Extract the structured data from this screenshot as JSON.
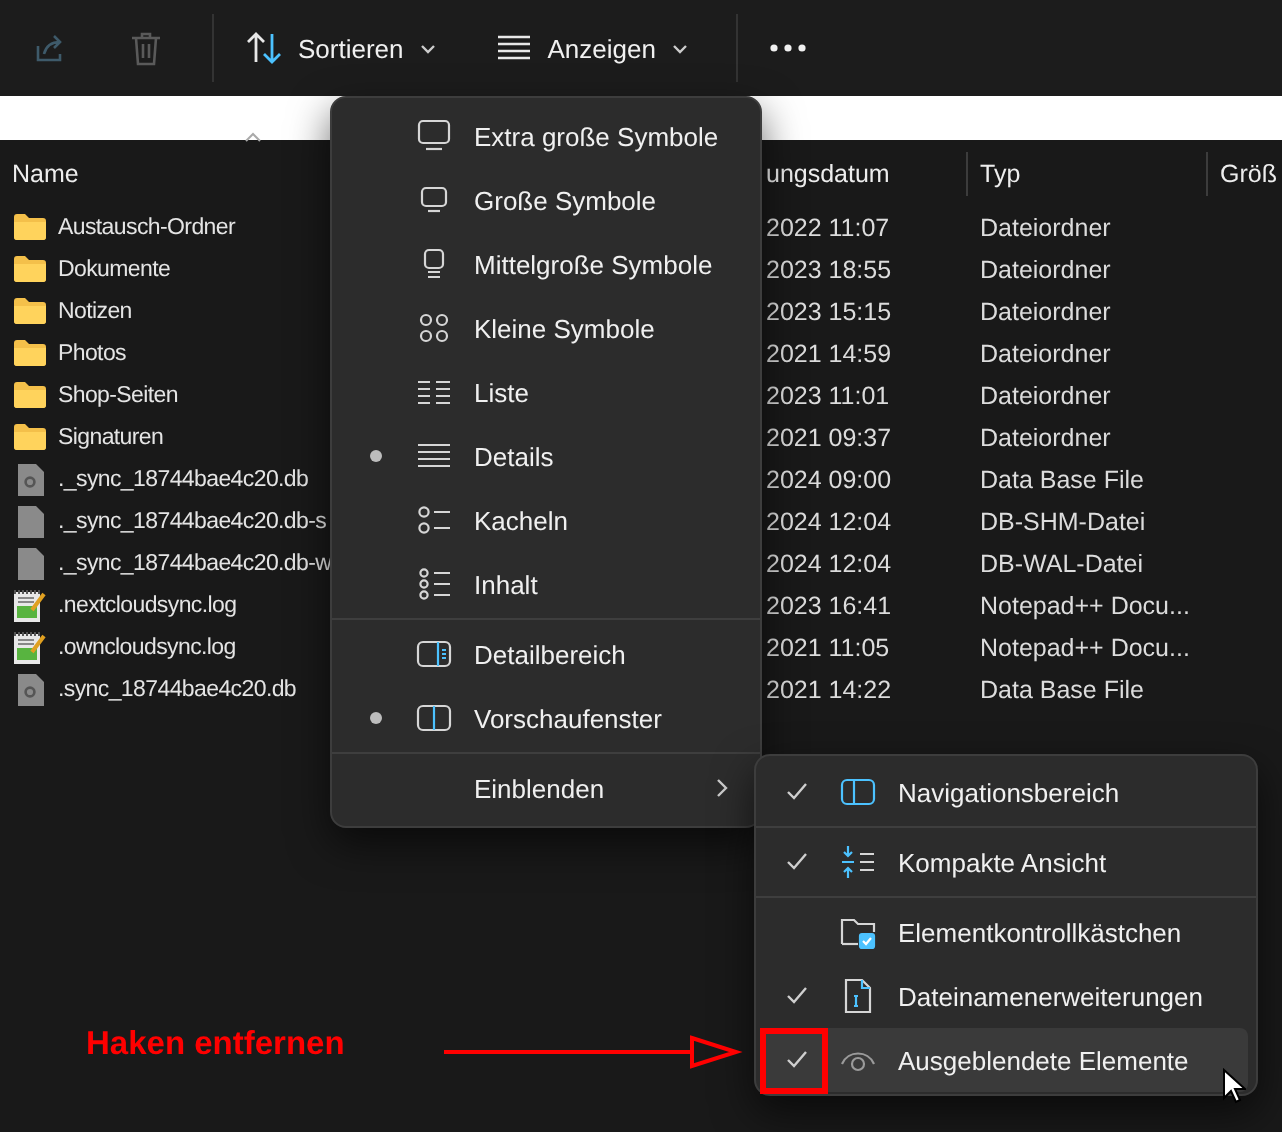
{
  "toolbar": {
    "items": [
      {
        "kind": "share",
        "disabled": true
      },
      {
        "kind": "delete",
        "disabled": true
      },
      {
        "kind": "sort",
        "label": "Sortieren",
        "disabled": false
      },
      {
        "kind": "view",
        "label": "Anzeigen",
        "disabled": false
      },
      {
        "kind": "more",
        "disabled": false
      }
    ]
  },
  "table": {
    "columns": [
      "Name",
      "ungsdatum",
      "Typ",
      "Größ"
    ],
    "rows": [
      {
        "kind": "folder",
        "name": "Austausch-Ordner",
        "date": "2022 11:07",
        "type": "Dateiordner"
      },
      {
        "kind": "folder",
        "name": "Dokumente",
        "date": "2023 18:55",
        "type": "Dateiordner"
      },
      {
        "kind": "folder",
        "name": "Notizen",
        "date": "2023 15:15",
        "type": "Dateiordner"
      },
      {
        "kind": "folder",
        "name": "Photos",
        "date": "2021 14:59",
        "type": "Dateiordner"
      },
      {
        "kind": "folder",
        "name": "Shop-Seiten",
        "date": "2023 11:01",
        "type": "Dateiordner"
      },
      {
        "kind": "folder",
        "name": "Signaturen",
        "date": "2021 09:37",
        "type": "Dateiordner"
      },
      {
        "kind": "database",
        "name": "._sync_18744bae4c20.db",
        "date": "2024 09:00",
        "type": "Data Base File"
      },
      {
        "kind": "file",
        "name": "._sync_18744bae4c20.db-s",
        "date": "2024 12:04",
        "type": "DB-SHM-Datei"
      },
      {
        "kind": "file",
        "name": "._sync_18744bae4c20.db-w",
        "date": "2024 12:04",
        "type": "DB-WAL-Datei"
      },
      {
        "kind": "notepad",
        "name": ".nextcloudsync.log",
        "date": "2023 16:41",
        "type": "Notepad++ Docu..."
      },
      {
        "kind": "notepad",
        "name": ".owncloudsync.log",
        "date": "2021 11:05",
        "type": "Notepad++ Docu..."
      },
      {
        "kind": "database",
        "name": ".sync_18744bae4c20.db",
        "date": "2021 14:22",
        "type": "Data Base File"
      }
    ]
  },
  "view_menu": {
    "groups": [
      {
        "items": [
          {
            "label": "Extra große Symbole",
            "selected": false
          },
          {
            "label": "Große Symbole",
            "selected": false
          },
          {
            "label": "Mittelgroße Symbole",
            "selected": false
          },
          {
            "label": "Kleine Symbole",
            "selected": false
          },
          {
            "label": "Liste",
            "selected": false
          },
          {
            "label": "Details",
            "selected": true
          },
          {
            "label": "Kacheln",
            "selected": false
          },
          {
            "label": "Inhalt",
            "selected": false
          }
        ]
      },
      {
        "items": [
          {
            "label": "Detailbereich",
            "selected": false
          },
          {
            "label": "Vorschaufenster",
            "selected": true
          }
        ]
      },
      {
        "items": [
          {
            "label": "Einblenden",
            "selected": false,
            "submenu": true
          }
        ]
      }
    ]
  },
  "show_submenu": {
    "groups": [
      {
        "items": [
          {
            "label": "Navigationsbereich",
            "checked": true,
            "highlighted": false
          }
        ]
      },
      {
        "items": [
          {
            "label": "Kompakte Ansicht",
            "checked": true,
            "highlighted": false
          }
        ]
      },
      {
        "items": [
          {
            "label": "Elementkontrollkästchen",
            "checked": false,
            "highlighted": false
          },
          {
            "label": "Dateinamenerweiterungen",
            "checked": true,
            "highlighted": false
          },
          {
            "label": "Ausgeblendete Elemente",
            "checked": true,
            "highlighted": true
          }
        ]
      }
    ]
  },
  "annotation": {
    "text": "Haken entfernen"
  }
}
